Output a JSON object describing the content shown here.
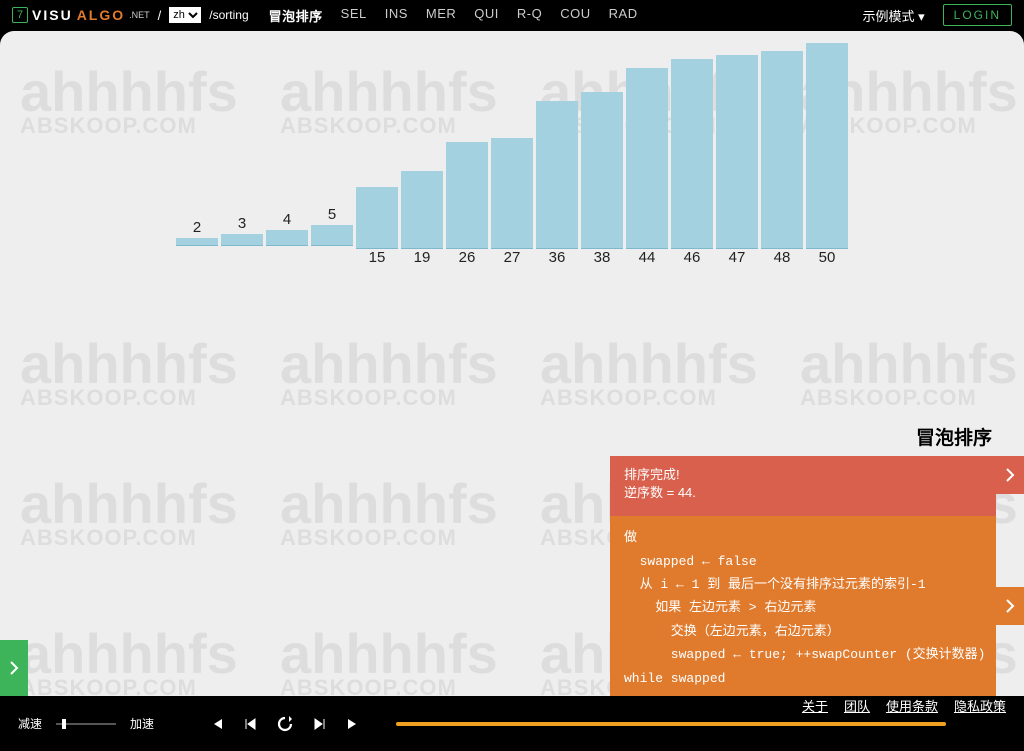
{
  "header": {
    "badge": "7",
    "logo_visu": "VISU",
    "logo_algo": "ALGO",
    "logo_net": ".NET",
    "slash1": "/",
    "lang_options": [
      "zh"
    ],
    "slash2": "/sorting",
    "tabs": [
      {
        "label": "冒泡排序",
        "active": true
      },
      {
        "label": "SEL",
        "active": false
      },
      {
        "label": "INS",
        "active": false
      },
      {
        "label": "MER",
        "active": false
      },
      {
        "label": "QUI",
        "active": false
      },
      {
        "label": "R-Q",
        "active": false
      },
      {
        "label": "COU",
        "active": false
      },
      {
        "label": "RAD",
        "active": false
      }
    ],
    "demo_mode": "示例模式 ▾",
    "login": "LOGIN"
  },
  "chart_data": {
    "type": "bar",
    "title": "",
    "xlabel": "",
    "ylabel": "",
    "ylim": [
      0,
      50
    ],
    "categories": [
      "2",
      "3",
      "4",
      "5",
      "15",
      "19",
      "26",
      "27",
      "36",
      "38",
      "44",
      "46",
      "47",
      "48",
      "50"
    ],
    "values": [
      2,
      3,
      4,
      5,
      15,
      19,
      26,
      27,
      36,
      38,
      44,
      46,
      47,
      48,
      50
    ]
  },
  "panel": {
    "title": "冒泡排序",
    "status_line1": "排序完成!",
    "status_line2": "逆序数 = 44.",
    "code": {
      "l0": "做",
      "l1": "  swapped ← false",
      "l2": "  从 i ← 1 到 最后一个没有排序过元素的索引-1",
      "l3": "    如果 左边元素 > 右边元素",
      "l4": "      交换（左边元素，右边元素）",
      "l5": "      swapped ← true; ++swapCounter (交换计数器)",
      "l6": "while swapped"
    }
  },
  "player": {
    "slow": "减速",
    "fast": "加速"
  },
  "footer": {
    "about": "关于",
    "team": "团队",
    "terms": "使用条款",
    "privacy": "隐私政策"
  },
  "watermarks": {
    "big": "ahhhhfs",
    "small": "ABSKOOP.COM"
  }
}
